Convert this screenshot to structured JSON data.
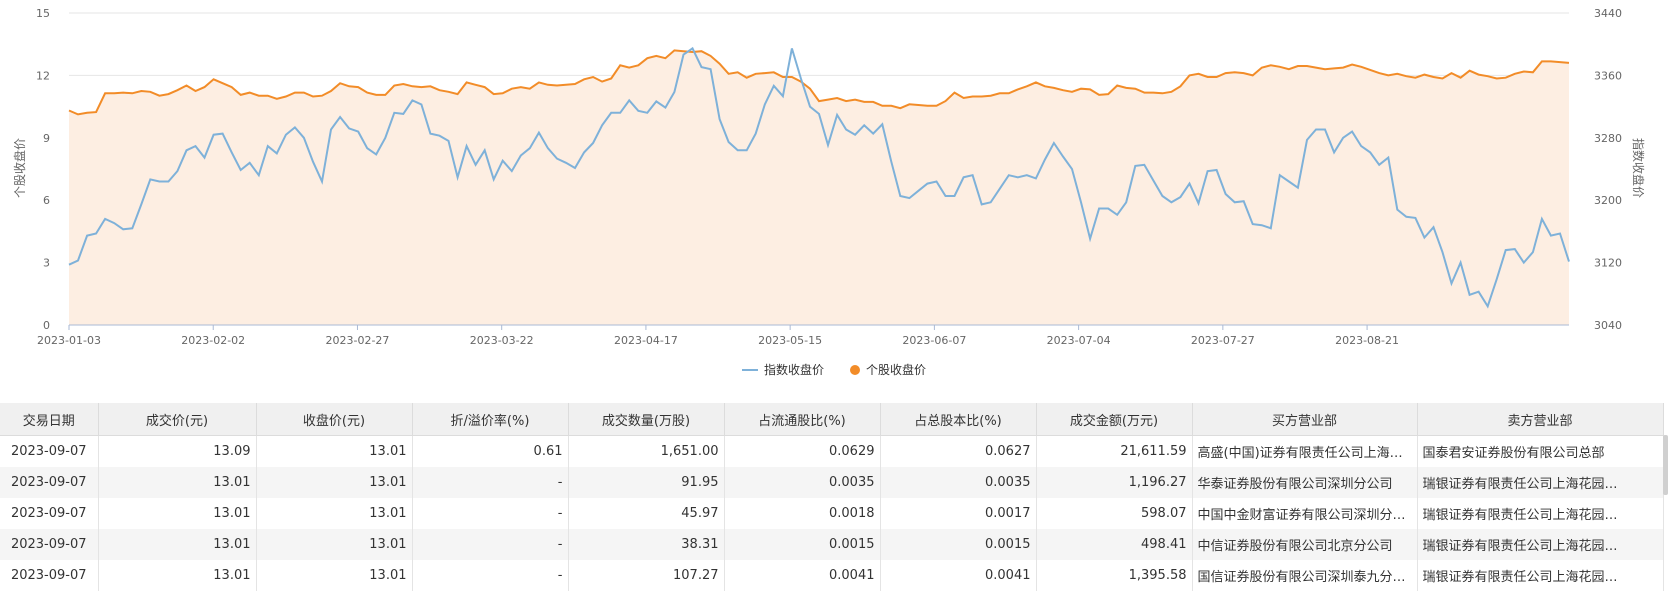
{
  "chart_data": {
    "type": "line",
    "ylabel_left": "个股收盘价",
    "ylabel_right": "指数收盘价",
    "y_left_ticks": [
      "0",
      "3",
      "6",
      "9",
      "12",
      "15"
    ],
    "y_right_ticks": [
      "3040",
      "3120",
      "3200",
      "3280",
      "3360",
      "3440"
    ],
    "ylim_left": [
      0,
      15
    ],
    "ylim_right": [
      3040,
      3440
    ],
    "x_ticks": [
      "2023-01-03",
      "2023-02-02",
      "2023-02-27",
      "2023-03-22",
      "2023-04-17",
      "2023-05-15",
      "2023-06-07",
      "2023-07-04",
      "2023-07-27",
      "2023-08-21"
    ],
    "legend_position": "bottom",
    "grid": true,
    "series": [
      {
        "name": "指数收盘价",
        "color": "#7eb1d9",
        "axis": "left",
        "values": [
          2.9,
          3.1,
          4.3,
          4.4,
          5.1,
          4.9,
          4.6,
          4.65,
          5.8,
          7.0,
          6.9,
          6.9,
          7.4,
          8.4,
          8.6,
          8.05,
          9.15,
          9.2,
          8.3,
          7.45,
          7.8,
          7.2,
          8.6,
          8.25,
          9.15,
          9.5,
          9.0,
          7.85,
          6.9,
          9.4,
          10.0,
          9.45,
          9.3,
          8.5,
          8.2,
          9.0,
          10.2,
          10.15,
          10.8,
          10.6,
          9.2,
          9.1,
          8.85,
          7.1,
          8.6,
          7.7,
          8.4,
          7.0,
          7.9,
          7.4,
          8.15,
          8.5,
          9.25,
          8.5,
          8.0,
          7.8,
          7.55,
          8.3,
          8.75,
          9.6,
          10.2,
          10.2,
          10.8,
          10.3,
          10.2,
          10.75,
          10.45,
          11.2,
          13.0,
          13.3,
          12.4,
          12.3,
          9.9,
          8.8,
          8.4,
          8.4,
          9.2,
          10.6,
          11.5,
          11.0,
          13.3,
          11.85,
          10.5,
          10.15,
          8.65,
          10.1,
          9.4,
          9.15,
          9.6,
          9.2,
          9.65,
          7.85,
          6.2,
          6.1,
          6.45,
          6.8,
          6.9,
          6.2,
          6.2,
          7.1,
          7.2,
          5.8,
          5.9,
          6.55,
          7.2,
          7.1,
          7.2,
          7.05,
          7.95,
          8.75,
          8.1,
          7.5,
          5.9,
          4.15,
          5.6,
          5.6,
          5.3,
          5.9,
          7.65,
          7.7,
          6.95,
          6.2,
          5.9,
          6.15,
          6.8,
          5.85,
          7.4,
          7.45,
          6.3,
          5.9,
          5.95,
          4.85,
          4.8,
          4.65,
          7.2,
          6.9,
          6.6,
          8.9,
          9.4,
          9.4,
          8.3,
          9.0,
          9.3,
          8.6,
          8.3,
          7.7,
          8.05,
          5.55,
          5.2,
          5.15,
          4.2,
          4.7,
          3.5,
          2.0,
          3.0,
          1.45,
          1.6,
          0.9,
          2.2,
          3.6,
          3.65,
          3.0,
          3.5,
          5.1,
          4.3,
          4.4,
          3.05
        ]
      },
      {
        "name": "个股收盘价",
        "color": "#f28c28",
        "axis": "right",
        "values": [
          3315,
          3310,
          3312,
          3313,
          3337,
          3337,
          3338,
          3337,
          3340,
          3339,
          3334,
          3336,
          3341,
          3347,
          3340,
          3345,
          3355,
          3350,
          3345,
          3335,
          3338,
          3334,
          3334,
          3330,
          3333,
          3338,
          3338,
          3333,
          3334,
          3340,
          3350,
          3346,
          3345,
          3338,
          3335,
          3335,
          3347,
          3349,
          3346,
          3345,
          3346,
          3341,
          3339,
          3336,
          3351,
          3348,
          3345,
          3336,
          3337,
          3343,
          3345,
          3343,
          3351,
          3348,
          3347,
          3348,
          3349,
          3355,
          3358,
          3352,
          3356,
          3373,
          3370,
          3373,
          3382,
          3385,
          3382,
          3392,
          3391,
          3390,
          3391,
          3385,
          3375,
          3362,
          3364,
          3357,
          3362,
          3363,
          3364,
          3358,
          3358,
          3352,
          3343,
          3327,
          3329,
          3331,
          3327,
          3329,
          3326,
          3326,
          3321,
          3321,
          3318,
          3323,
          3322,
          3321,
          3321,
          3327,
          3338,
          3331,
          3333,
          3333,
          3334,
          3337,
          3337,
          3342,
          3346,
          3351,
          3346,
          3344,
          3341,
          3339,
          3343,
          3342,
          3335,
          3336,
          3347,
          3344,
          3343,
          3338,
          3338,
          3337,
          3339,
          3346,
          3360,
          3362,
          3358,
          3358,
          3363,
          3364,
          3363,
          3360,
          3370,
          3373,
          3371,
          3368,
          3372,
          3372,
          3370,
          3368,
          3369,
          3370,
          3374,
          3371,
          3367,
          3363,
          3360,
          3362,
          3359,
          3357,
          3361,
          3358,
          3356,
          3363,
          3357,
          3366,
          3361,
          3359,
          3356,
          3357,
          3362,
          3365,
          3364,
          3378,
          3378,
          3377,
          3376
        ]
      }
    ]
  },
  "legend": {
    "index_label": "指数收盘价",
    "stock_label": "个股收盘价"
  },
  "table": {
    "headers": [
      "交易日期",
      "成交价(元)",
      "收盘价(元)",
      "折/溢价率(%)",
      "成交数量(万股)",
      "占流通股比(%)",
      "占总股本比(%)",
      "成交金额(万元)",
      "买方营业部",
      "卖方营业部"
    ],
    "rows": [
      [
        "2023-09-07",
        "13.09",
        "13.01",
        "0.61",
        "1,651.00",
        "0.0629",
        "0.0627",
        "21,611.59",
        "高盛(中国)证券有限责任公司上海…",
        "国泰君安证券股份有限公司总部"
      ],
      [
        "2023-09-07",
        "13.01",
        "13.01",
        "-",
        "91.95",
        "0.0035",
        "0.0035",
        "1,196.27",
        "华泰证券股份有限公司深圳分公司",
        "瑞银证券有限责任公司上海花园…"
      ],
      [
        "2023-09-07",
        "13.01",
        "13.01",
        "-",
        "45.97",
        "0.0018",
        "0.0017",
        "598.07",
        "中国中金财富证券有限公司深圳分…",
        "瑞银证券有限责任公司上海花园…"
      ],
      [
        "2023-09-07",
        "13.01",
        "13.01",
        "-",
        "38.31",
        "0.0015",
        "0.0015",
        "498.41",
        "中信证券股份有限公司北京分公司",
        "瑞银证券有限责任公司上海花园…"
      ],
      [
        "2023-09-07",
        "13.01",
        "13.01",
        "-",
        "107.27",
        "0.0041",
        "0.0041",
        "1,395.58",
        "国信证券股份有限公司深圳泰九分…",
        "瑞银证券有限责任公司上海花园…"
      ]
    ]
  }
}
